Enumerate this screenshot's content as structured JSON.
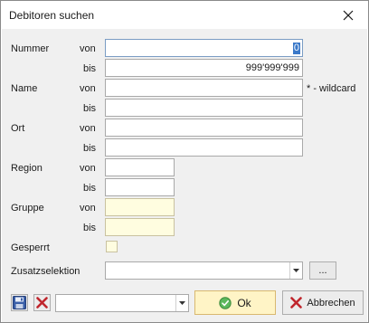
{
  "window": {
    "title": "Debitoren suchen"
  },
  "labels": {
    "nummer": "Nummer",
    "name": "Name",
    "ort": "Ort",
    "region": "Region",
    "gruppe": "Gruppe",
    "gesperrt": "Gesperrt",
    "zusatzselektion": "Zusatzselektion",
    "von": "von",
    "bis": "bis",
    "wildcard_hint": "* - wildcard"
  },
  "fields": {
    "nummer_von": "0",
    "nummer_bis": "999'999'999",
    "name_von": "",
    "name_bis": "",
    "ort_von": "",
    "ort_bis": "",
    "region_von": "",
    "region_bis": "",
    "gruppe_von": "",
    "gruppe_bis": "",
    "zusatzselektion": "",
    "bottom_combo": ""
  },
  "checkboxes": {
    "gesperrt": false
  },
  "buttons": {
    "browse": "...",
    "ok": "Ok",
    "cancel": "Abbrechen"
  },
  "icons": [
    "close-icon",
    "save-icon",
    "delete-icon",
    "ok-check-icon",
    "cancel-x-icon",
    "dropdown-arrow-icon"
  ]
}
